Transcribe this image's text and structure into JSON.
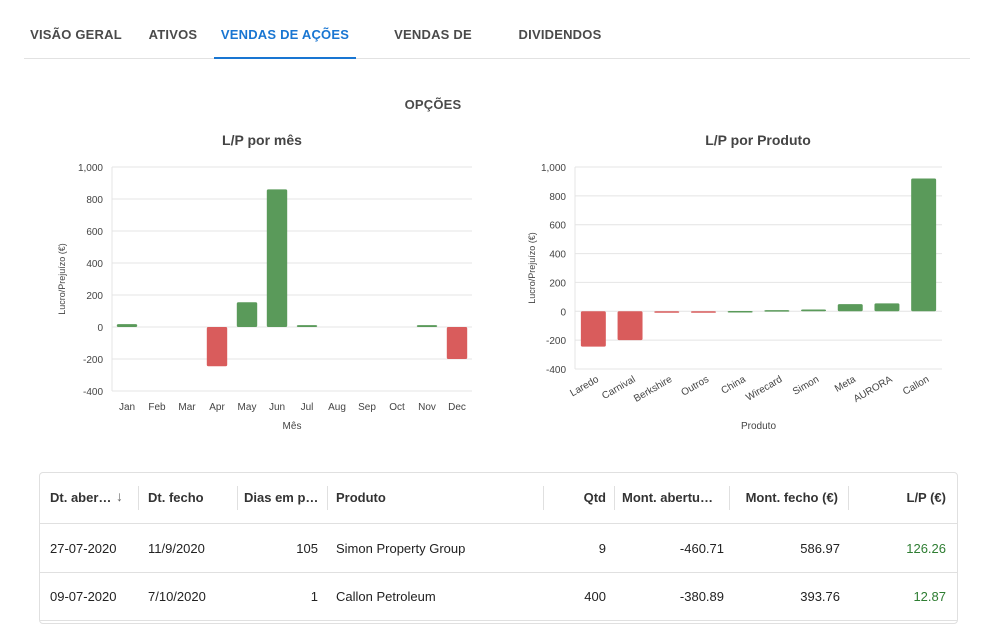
{
  "tabs": [
    {
      "label": "VISÃO GERAL"
    },
    {
      "label": "ATIVOS"
    },
    {
      "label": "VENDAS DE AÇÕES"
    },
    {
      "label": "VENDAS DE OPÇÕES"
    },
    {
      "label": "DIVIDENDOS"
    }
  ],
  "active_tab": 2,
  "colors": {
    "accent": "#1976d2",
    "positive": "#5a9a5a",
    "negative": "#d95c5c",
    "positive_text": "#2e7d32"
  },
  "chart_data": [
    {
      "type": "bar",
      "title": "L/P por mês",
      "xlabel": "Mês",
      "ylabel": "Lucro/Prejuízo (€)",
      "categories": [
        "Jan",
        "Feb",
        "Mar",
        "Apr",
        "May",
        "Jun",
        "Jul",
        "Aug",
        "Sep",
        "Oct",
        "Nov",
        "Dec"
      ],
      "values": [
        18,
        0,
        0,
        -245,
        155,
        860,
        12,
        0,
        0,
        0,
        12,
        -200
      ],
      "ylim": [
        -400,
        1000
      ],
      "yticks": [
        -400,
        -200,
        0,
        200,
        400,
        600,
        800,
        1000
      ],
      "ytick_labels": [
        "-400",
        "-200",
        "0",
        "200",
        "400",
        "600",
        "800",
        "1,000"
      ],
      "grid": true
    },
    {
      "type": "bar",
      "title": "L/P por Produto",
      "xlabel": "Produto",
      "ylabel": "Lucro/Prejuízo (€)",
      "categories": [
        "Laredo",
        "Carnival",
        "Berkshire",
        "Outros",
        "China",
        "Wirecard",
        "Simon",
        "Meta",
        "AURORA",
        "Callon"
      ],
      "values": [
        -245,
        -200,
        -8,
        -2,
        2,
        8,
        12,
        50,
        55,
        920
      ],
      "ylim": [
        -400,
        1000
      ],
      "yticks": [
        -400,
        -200,
        0,
        200,
        400,
        600,
        800,
        1000
      ],
      "ytick_labels": [
        "-400",
        "-200",
        "0",
        "200",
        "400",
        "600",
        "800",
        "1,000"
      ],
      "grid": true
    }
  ],
  "table": {
    "headers": [
      "Dt. abertura",
      "Dt. fecho",
      "Dias em posse",
      "Produto",
      "Qtd",
      "Mont. abertura (€)",
      "Mont. fecho (€)",
      "L/P (€)"
    ],
    "rows": [
      [
        "27-07-2020",
        "11/9/2020",
        "105",
        "Simon Property Group",
        "9",
        "-460.71",
        "586.97",
        "126.26"
      ],
      [
        "09-07-2020",
        "7/10/2020",
        "1",
        "Callon Petroleum",
        "400",
        "-380.89",
        "393.76",
        "12.87"
      ]
    ]
  }
}
